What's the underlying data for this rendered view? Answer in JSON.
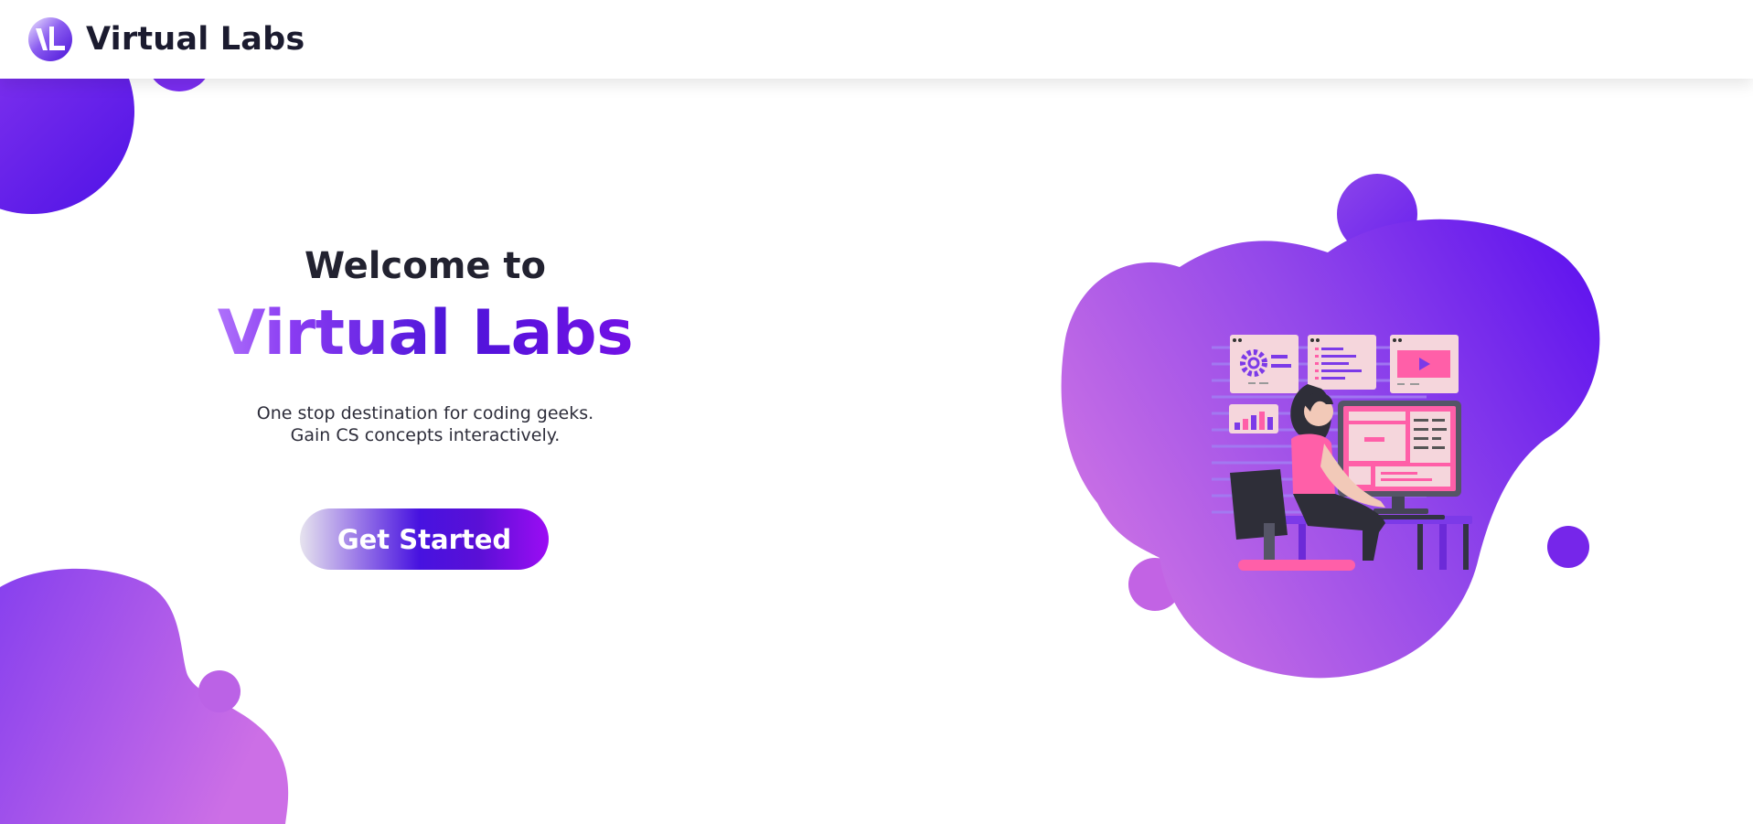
{
  "navbar": {
    "brand_name": "Virtual Labs",
    "logo_icon": "vl-logo-icon"
  },
  "hero": {
    "welcome": "Welcome to",
    "title": "Virtual Labs",
    "tagline_line1": "One stop destination for coding geeks.",
    "tagline_line2": "Gain CS concepts interactively.",
    "cta_label": "Get Started"
  },
  "illustration": {
    "name": "developer-at-computer-illustration",
    "icons": [
      "gear-icon",
      "play-icon",
      "bar-chart-icon"
    ]
  },
  "colors": {
    "accent_purple": "#5b14e6",
    "accent_violet": "#9b0cf2",
    "blob_light": "#c77be6",
    "blob_dark": "#5e1cf0",
    "screen_pink": "#ff5fa8"
  }
}
